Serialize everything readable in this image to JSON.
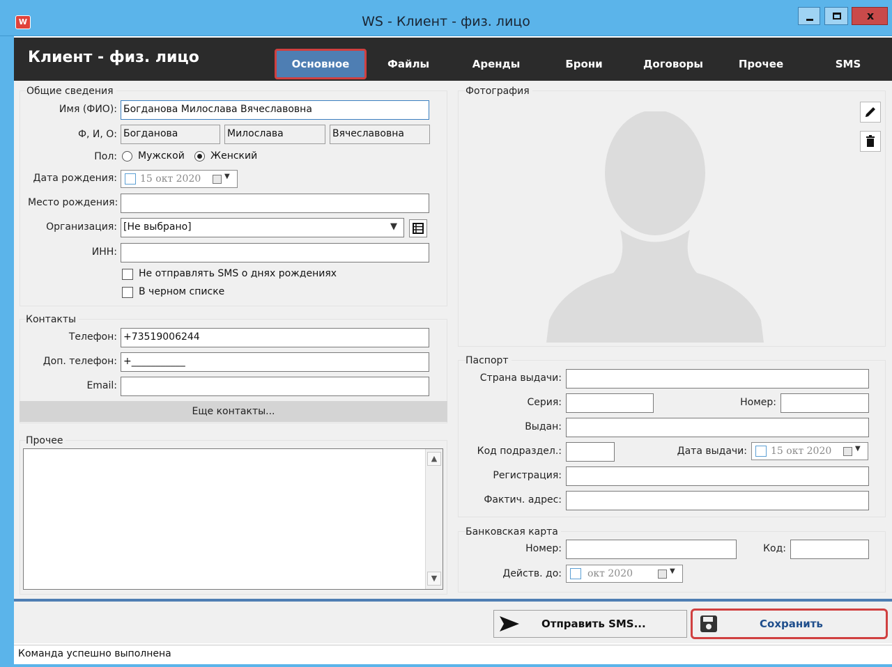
{
  "window": {
    "title": "WS - Клиент - физ. лицо",
    "close_glyph": "x",
    "app_icon_text": "W"
  },
  "header": {
    "title": "Клиент - физ. лицо",
    "tabs": [
      "Основное",
      "Файлы",
      "Аренды",
      "Брони",
      "Договоры",
      "Прочее",
      "SMS"
    ],
    "active_tab": "Основное"
  },
  "general": {
    "group_label": "Общие сведения",
    "fio_label": "Имя (ФИО):",
    "fio_value": "Богданова Милослава Вячеславовна",
    "fio_parts_label": "Ф, И, О:",
    "last_name": "Богданова",
    "first_name": "Милослава",
    "middle_name": "Вячеславовна",
    "gender_label": "Пол:",
    "gender_male": "Мужской",
    "gender_female": "Женский",
    "gender_selected": "Женский",
    "birth_date_label": "Дата рождения:",
    "birth_date_value": "15 окт 2020",
    "birth_place_label": "Место рождения:",
    "birth_place_value": "",
    "organization_label": "Организация:",
    "organization_value": "[Не выбрано]",
    "inn_label": "ИНН:",
    "inn_value": "",
    "no_birthday_sms_label": "Не отправлять SMS о днях рождениях",
    "blacklist_label": "В черном списке"
  },
  "contacts": {
    "group_label": "Контакты",
    "phone_label": "Телефон:",
    "phone_value": "+73519006244",
    "extra_phone_label": "Доп. телефон:",
    "extra_phone_value": "+___________",
    "email_label": "Email:",
    "email_value": "",
    "more_contacts": "Еще контакты..."
  },
  "other": {
    "group_label": "Прочее",
    "notes_value": ""
  },
  "photo": {
    "group_label": "Фотография"
  },
  "passport": {
    "group_label": "Паспорт",
    "country_label": "Страна выдачи:",
    "series_label": "Серия:",
    "number_label": "Номер:",
    "issued_by_label": "Выдан:",
    "dept_code_label": "Код подраздел.:",
    "issue_date_label": "Дата выдачи:",
    "issue_date_value": "15 окт 2020",
    "registration_label": "Регистрация:",
    "actual_address_label": "Фактич. адрес:"
  },
  "bank_card": {
    "group_label": "Банковская карта",
    "number_label": "Номер:",
    "code_label": "Код:",
    "valid_until_label": "Действ. до:",
    "valid_until_value": "окт 2020"
  },
  "actions": {
    "send_sms": "Отправить SMS...",
    "save": "Сохранить"
  },
  "status": {
    "text": "Команда успешно выполнена"
  },
  "colors": {
    "titlebar": "#5bb4ea",
    "header": "#2b2b2b",
    "active_tab": "#4e7eb3",
    "highlight": "#d04040",
    "save_text": "#1f4e8c"
  }
}
